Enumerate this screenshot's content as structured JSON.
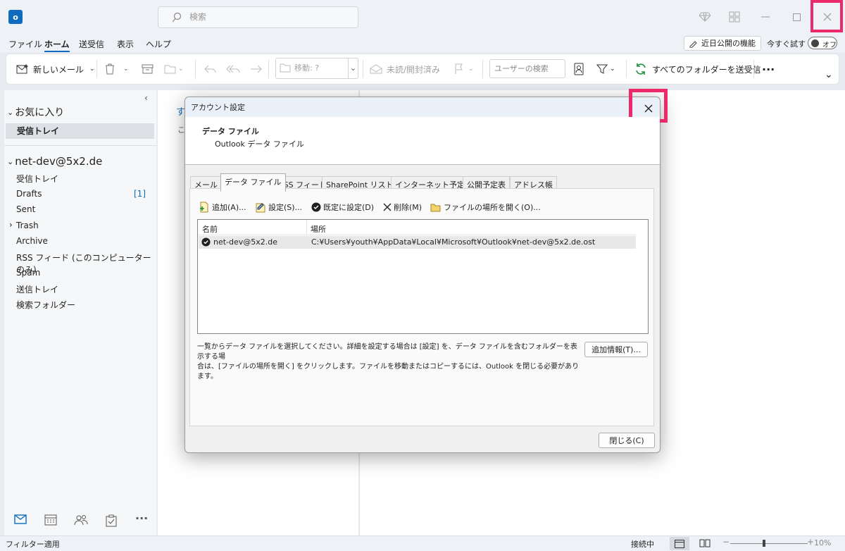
{
  "colors": {
    "accent": "#0f6cbd",
    "highlight": "#ec2a6b"
  },
  "app": {
    "logo_letter": "o",
    "search_placeholder": "検索"
  },
  "menu": {
    "items": [
      "ファイル",
      "ホーム",
      "送受信",
      "表示",
      "ヘルプ"
    ],
    "feature_button": "近日公開の機能",
    "try_now": "今すぐ試す",
    "toggle_state": "オフ"
  },
  "ribbon": {
    "new_mail": "新しいメール",
    "move_placeholder": "移動: ?",
    "unread_read": "未読/開封済み",
    "user_search_placeholder": "ユーザーの検索",
    "send_receive_all": "すべてのフォルダーを送受信",
    "more": "···"
  },
  "sidebar": {
    "favorites_header": "お気に入り",
    "favorites_inbox": "受信トレイ",
    "account_header": "net-dev@5x2.de",
    "folders": [
      "受信トレイ",
      "Drafts",
      "Sent",
      "Trash",
      "Archive",
      "RSS フィード (このコンピューターのみ)",
      "Spam",
      "送信トレイ",
      "検索フォルダー"
    ],
    "drafts_count": "[1]"
  },
  "midpane": {
    "tab_fragment": "す",
    "sub_fragment": "こ"
  },
  "status": {
    "filter": "フィルター適用",
    "connection": "接続中",
    "zoom": "10%"
  },
  "dialog": {
    "title": "アカウント設定",
    "header_title": "データ ファイル",
    "header_subtitle": "Outlook データ ファイル",
    "tabs": [
      "メール",
      "データ ファイル",
      "RSS フィード",
      "SharePoint リスト",
      "インターネット予定表",
      "公開予定表",
      "アドレス帳"
    ],
    "toolbar": {
      "add": "追加(A)...",
      "settings": "設定(S)...",
      "set_default": "既定に設定(D)",
      "remove": "削除(M)",
      "open_location": "ファイルの場所を開く(O)..."
    },
    "columns": {
      "name": "名前",
      "location": "場所"
    },
    "rows": [
      {
        "name": "net-dev@5x2.de",
        "location": "C:¥Users¥youth¥AppData¥Local¥Microsoft¥Outlook¥net-dev@5x2.de.ost"
      }
    ],
    "description_line1": "一覧からデータ ファイルを選択してください。詳細を設定する場合は [設定] を、データ ファイルを含むフォルダーを表示する場",
    "description_line2": "合は、[ファイルの場所を開く] をクリックします。ファイルを移動またはコピーするには、Outlook を閉じる必要があります。",
    "more_info_button": "追加情報(T)...",
    "close_button": "閉じる(C)"
  }
}
